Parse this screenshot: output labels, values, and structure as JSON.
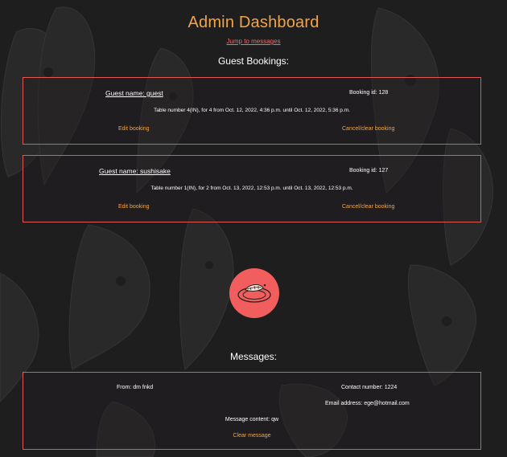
{
  "page": {
    "title": "Admin Dashboard",
    "jump_link": "Jump to messages",
    "guest_bookings_heading": "Guest Bookings:",
    "messages_heading": "Messages:"
  },
  "bookings": [
    {
      "guest_label": "Guest name: guest",
      "booking_id_label": "Booking id: 128",
      "details": "Table number 4(IN), for 4 from Oct. 12, 2022, 4:36 p.m. until Oct. 12, 2022, 5:36 p.m.",
      "edit_label": "Edit booking",
      "cancel_label": "Cancel/clear booking"
    },
    {
      "guest_label": "Guest name: sushisake",
      "booking_id_label": "Booking id: 127",
      "details": "Table number 1(IN), for 2 from Oct. 13, 2022, 12:53 p.m. until Oct. 13, 2022, 12:53 p.m.",
      "edit_label": "Edit booking",
      "cancel_label": "Cancel/clear booking"
    }
  ],
  "messages": [
    {
      "from_label": "From: dm fnkd",
      "contact_label": "Contact number: 1224",
      "email_label": "Email address: ege@hotmail.com",
      "content_label": "Message content: qw",
      "clear_label": "Clear message"
    }
  ],
  "colors": {
    "background": "#1f1e1f",
    "accent": "#f2a447",
    "border": "#e05a55",
    "link": "#f06b6b",
    "logo": "#f25e5e"
  },
  "icons": {
    "logo": "sushi-plate-logo",
    "background": "koi-fish-pattern"
  }
}
